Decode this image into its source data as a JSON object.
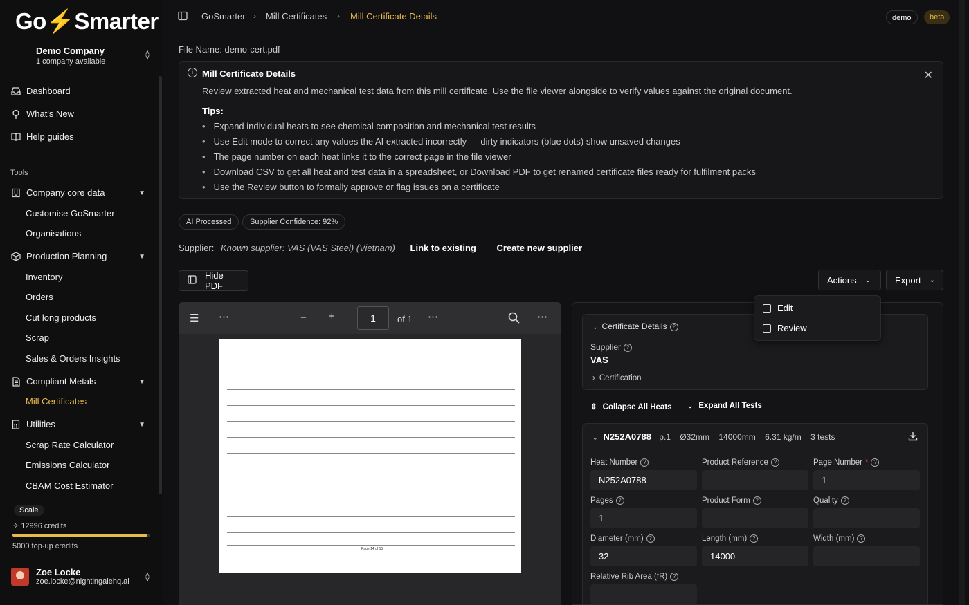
{
  "brand": {
    "logo_pre": "Go",
    "logo_bolt": "⚡",
    "logo_post": "Smarter",
    "accent": "#e9b949"
  },
  "company": {
    "name": "Demo Company",
    "sub": "1 company available"
  },
  "nav": {
    "dashboard": "Dashboard",
    "whats_new": "What's New",
    "help": "Help guides",
    "tools": "Tools"
  },
  "groups": {
    "core": {
      "label": "Company core data",
      "items": [
        "Customise GoSmarter",
        "Organisations"
      ]
    },
    "prod": {
      "label": "Production Planning",
      "items": [
        "Inventory",
        "Orders",
        "Cut long products",
        "Scrap",
        "Sales & Orders Insights"
      ]
    },
    "metals": {
      "label": "Compliant Metals",
      "items": [
        "Mill Certificates"
      ]
    },
    "util": {
      "label": "Utilities",
      "items": [
        "Scrap Rate Calculator",
        "Emissions Calculator",
        "CBAM Cost Estimator"
      ]
    }
  },
  "plan": {
    "badge": "Scale",
    "credits": "12996 credits",
    "credit_fraction": 0.98,
    "topup": "5000 top-up credits"
  },
  "user": {
    "name": "Zoe Locke",
    "email": "zoe.locke@nightingalehq.ai"
  },
  "breadcrumb": {
    "b1": "GoSmarter",
    "b2": "Mill Certificates",
    "b3": "Mill Certificate Details"
  },
  "badges": {
    "demo": "demo",
    "beta": "beta"
  },
  "file_name": "File Name: demo-cert.pdf",
  "info": {
    "title": "Mill Certificate Details",
    "desc": "Review extracted heat and mechanical test data from this mill certificate. Use the file viewer alongside to verify values against the original document.",
    "tips_title": "Tips:",
    "tips": [
      "Expand individual heats to see chemical composition and mechanical test results",
      "Use Edit mode to correct any values the AI extracted incorrectly — dirty indicators (blue dots) show unsaved changes",
      "The page number on each heat links it to the correct page in the file viewer",
      "Download CSV to get all heat and test data in a spreadsheet, or Download PDF to get renamed certificate files ready for fulfilment packs",
      "Use the Review button to formally approve or flag issues on a certificate"
    ]
  },
  "tags": {
    "ai": "AI Processed",
    "conf": "Supplier Confidence: 92%"
  },
  "supplier": {
    "label": "Supplier:",
    "value": "Known supplier: VAS (VAS Steel) (Vietnam)",
    "link": "Link to existing",
    "create": "Create new supplier"
  },
  "buttons": {
    "hide_pdf": "Hide PDF",
    "actions": "Actions",
    "export": "Export"
  },
  "pdf": {
    "page": "1",
    "of": "of 1",
    "footer": "Page 14 of 15"
  },
  "dropdown": {
    "edit": "Edit",
    "review": "Review"
  },
  "cert": {
    "section": "Certificate Details",
    "supplier_label": "Supplier",
    "supplier_value": "VAS",
    "certification": "Certification"
  },
  "heats": {
    "collapse": "Collapse All Heats",
    "expand": "Expand All Tests"
  },
  "heat": {
    "id": "N252A0788",
    "page": "p.1",
    "dia": "Ø32mm",
    "len": "14000mm",
    "mass": "6.31 kg/m",
    "tests": "3 tests",
    "fields": {
      "heat_number": {
        "label": "Heat Number",
        "value": "N252A0788"
      },
      "product_ref": {
        "label": "Product Reference",
        "value": "—"
      },
      "page_number": {
        "label": "Page Number",
        "value": "1"
      },
      "pages": {
        "label": "Pages",
        "value": "1"
      },
      "product_form": {
        "label": "Product Form",
        "value": "—"
      },
      "quality": {
        "label": "Quality",
        "value": "—"
      },
      "diameter": {
        "label": "Diameter (mm)",
        "value": "32"
      },
      "length": {
        "label": "Length (mm)",
        "value": "14000"
      },
      "width": {
        "label": "Width (mm)",
        "value": "—"
      },
      "rib": {
        "label": "Relative Rib Area (fR)",
        "value": "—"
      }
    }
  }
}
